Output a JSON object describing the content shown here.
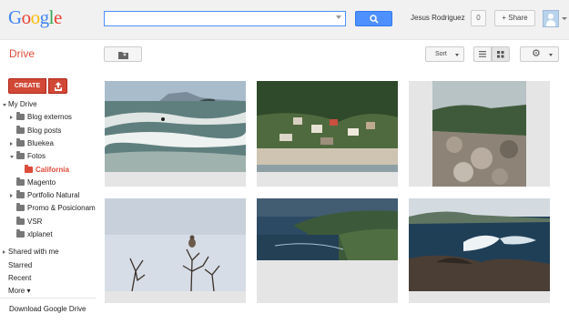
{
  "header": {
    "logo_letters": [
      "G",
      "o",
      "o",
      "g",
      "l",
      "e"
    ],
    "search_placeholder": "",
    "user_name": "Jesus Rodriguez",
    "notification_count": "0",
    "share_label": "+ Share"
  },
  "toolbar": {
    "title": "Drive",
    "sort_label": "Sort"
  },
  "sidebar": {
    "create_label": "CREATE",
    "tree": [
      {
        "label": "My Drive",
        "indent": 0,
        "arrow": "down",
        "folder": false
      },
      {
        "label": "Blog externos",
        "indent": 1,
        "arrow": "right",
        "folder": true
      },
      {
        "label": "Blog posts",
        "indent": 1,
        "arrow": "",
        "folder": true
      },
      {
        "label": "Bluekea",
        "indent": 1,
        "arrow": "right",
        "folder": true
      },
      {
        "label": "Fotos",
        "indent": 1,
        "arrow": "down",
        "folder": true
      },
      {
        "label": "California",
        "indent": 2,
        "arrow": "",
        "folder": true,
        "selected": true
      },
      {
        "label": "Magento",
        "indent": 1,
        "arrow": "",
        "folder": true
      },
      {
        "label": "Portfolio Natural",
        "indent": 1,
        "arrow": "right",
        "folder": true
      },
      {
        "label": "Promo & Posicionam",
        "indent": 1,
        "arrow": "",
        "folder": true
      },
      {
        "label": "VSR",
        "indent": 1,
        "arrow": "",
        "folder": true
      },
      {
        "label": "xlplanet",
        "indent": 1,
        "arrow": "",
        "folder": true
      },
      {
        "label": "Shared with me",
        "indent": 0,
        "arrow": "right",
        "folder": false
      },
      {
        "label": "Starred",
        "indent": 0,
        "arrow": "",
        "folder": false
      },
      {
        "label": "Recent",
        "indent": 0,
        "arrow": "",
        "folder": false
      },
      {
        "label": "More ▾",
        "indent": 0,
        "arrow": "",
        "folder": false
      }
    ],
    "download_label": "Download Google Drive"
  },
  "photos": [
    {
      "name": "photo-surfer-waves"
    },
    {
      "name": "photo-coastal-town"
    },
    {
      "name": "photo-rocky-cove"
    },
    {
      "name": "photo-bird-on-branches"
    },
    {
      "name": "photo-coastal-cliffs-bridge"
    },
    {
      "name": "photo-crashing-wave-rocks"
    }
  ],
  "colors": {
    "accent_red": "#dd4b39",
    "create_red": "#d14836",
    "search_blue": "#4d90fe"
  }
}
